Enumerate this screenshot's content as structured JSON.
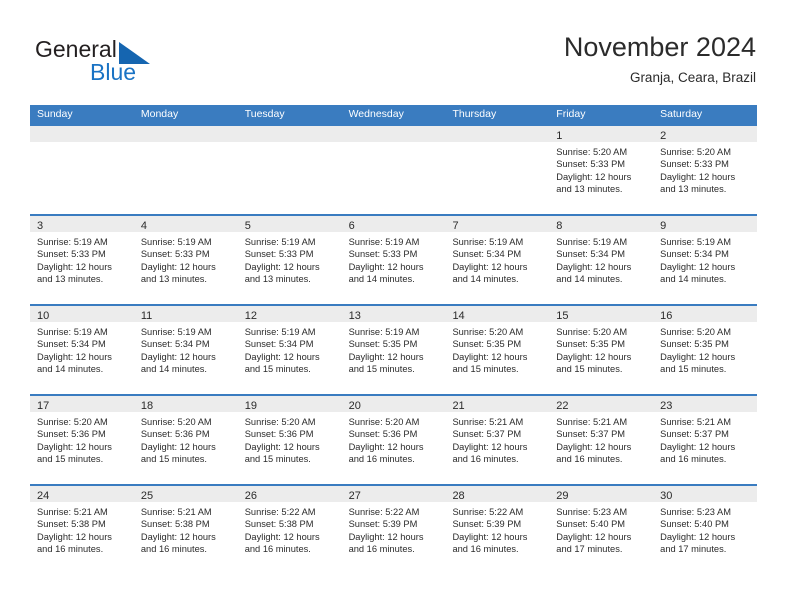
{
  "brand": {
    "name_part1": "General",
    "name_part2": "Blue",
    "logo_icon": "triangle-logo-icon",
    "accent_color": "#1565b0"
  },
  "header": {
    "title": "November 2024",
    "subtitle": "Granja, Ceara, Brazil"
  },
  "calendar": {
    "header_bg": "#3a7cc0",
    "daynum_bg": "#ececec",
    "weekdays": [
      "Sunday",
      "Monday",
      "Tuesday",
      "Wednesday",
      "Thursday",
      "Friday",
      "Saturday"
    ],
    "weeks": [
      [
        {
          "day": "",
          "sunrise": "",
          "sunset": "",
          "daylight_line1": "",
          "daylight_line2": ""
        },
        {
          "day": "",
          "sunrise": "",
          "sunset": "",
          "daylight_line1": "",
          "daylight_line2": ""
        },
        {
          "day": "",
          "sunrise": "",
          "sunset": "",
          "daylight_line1": "",
          "daylight_line2": ""
        },
        {
          "day": "",
          "sunrise": "",
          "sunset": "",
          "daylight_line1": "",
          "daylight_line2": ""
        },
        {
          "day": "",
          "sunrise": "",
          "sunset": "",
          "daylight_line1": "",
          "daylight_line2": ""
        },
        {
          "day": "1",
          "sunrise": "Sunrise: 5:20 AM",
          "sunset": "Sunset: 5:33 PM",
          "daylight_line1": "Daylight: 12 hours",
          "daylight_line2": "and 13 minutes."
        },
        {
          "day": "2",
          "sunrise": "Sunrise: 5:20 AM",
          "sunset": "Sunset: 5:33 PM",
          "daylight_line1": "Daylight: 12 hours",
          "daylight_line2": "and 13 minutes."
        }
      ],
      [
        {
          "day": "3",
          "sunrise": "Sunrise: 5:19 AM",
          "sunset": "Sunset: 5:33 PM",
          "daylight_line1": "Daylight: 12 hours",
          "daylight_line2": "and 13 minutes."
        },
        {
          "day": "4",
          "sunrise": "Sunrise: 5:19 AM",
          "sunset": "Sunset: 5:33 PM",
          "daylight_line1": "Daylight: 12 hours",
          "daylight_line2": "and 13 minutes."
        },
        {
          "day": "5",
          "sunrise": "Sunrise: 5:19 AM",
          "sunset": "Sunset: 5:33 PM",
          "daylight_line1": "Daylight: 12 hours",
          "daylight_line2": "and 13 minutes."
        },
        {
          "day": "6",
          "sunrise": "Sunrise: 5:19 AM",
          "sunset": "Sunset: 5:33 PM",
          "daylight_line1": "Daylight: 12 hours",
          "daylight_line2": "and 14 minutes."
        },
        {
          "day": "7",
          "sunrise": "Sunrise: 5:19 AM",
          "sunset": "Sunset: 5:34 PM",
          "daylight_line1": "Daylight: 12 hours",
          "daylight_line2": "and 14 minutes."
        },
        {
          "day": "8",
          "sunrise": "Sunrise: 5:19 AM",
          "sunset": "Sunset: 5:34 PM",
          "daylight_line1": "Daylight: 12 hours",
          "daylight_line2": "and 14 minutes."
        },
        {
          "day": "9",
          "sunrise": "Sunrise: 5:19 AM",
          "sunset": "Sunset: 5:34 PM",
          "daylight_line1": "Daylight: 12 hours",
          "daylight_line2": "and 14 minutes."
        }
      ],
      [
        {
          "day": "10",
          "sunrise": "Sunrise: 5:19 AM",
          "sunset": "Sunset: 5:34 PM",
          "daylight_line1": "Daylight: 12 hours",
          "daylight_line2": "and 14 minutes."
        },
        {
          "day": "11",
          "sunrise": "Sunrise: 5:19 AM",
          "sunset": "Sunset: 5:34 PM",
          "daylight_line1": "Daylight: 12 hours",
          "daylight_line2": "and 14 minutes."
        },
        {
          "day": "12",
          "sunrise": "Sunrise: 5:19 AM",
          "sunset": "Sunset: 5:34 PM",
          "daylight_line1": "Daylight: 12 hours",
          "daylight_line2": "and 15 minutes."
        },
        {
          "day": "13",
          "sunrise": "Sunrise: 5:19 AM",
          "sunset": "Sunset: 5:35 PM",
          "daylight_line1": "Daylight: 12 hours",
          "daylight_line2": "and 15 minutes."
        },
        {
          "day": "14",
          "sunrise": "Sunrise: 5:20 AM",
          "sunset": "Sunset: 5:35 PM",
          "daylight_line1": "Daylight: 12 hours",
          "daylight_line2": "and 15 minutes."
        },
        {
          "day": "15",
          "sunrise": "Sunrise: 5:20 AM",
          "sunset": "Sunset: 5:35 PM",
          "daylight_line1": "Daylight: 12 hours",
          "daylight_line2": "and 15 minutes."
        },
        {
          "day": "16",
          "sunrise": "Sunrise: 5:20 AM",
          "sunset": "Sunset: 5:35 PM",
          "daylight_line1": "Daylight: 12 hours",
          "daylight_line2": "and 15 minutes."
        }
      ],
      [
        {
          "day": "17",
          "sunrise": "Sunrise: 5:20 AM",
          "sunset": "Sunset: 5:36 PM",
          "daylight_line1": "Daylight: 12 hours",
          "daylight_line2": "and 15 minutes."
        },
        {
          "day": "18",
          "sunrise": "Sunrise: 5:20 AM",
          "sunset": "Sunset: 5:36 PM",
          "daylight_line1": "Daylight: 12 hours",
          "daylight_line2": "and 15 minutes."
        },
        {
          "day": "19",
          "sunrise": "Sunrise: 5:20 AM",
          "sunset": "Sunset: 5:36 PM",
          "daylight_line1": "Daylight: 12 hours",
          "daylight_line2": "and 15 minutes."
        },
        {
          "day": "20",
          "sunrise": "Sunrise: 5:20 AM",
          "sunset": "Sunset: 5:36 PM",
          "daylight_line1": "Daylight: 12 hours",
          "daylight_line2": "and 16 minutes."
        },
        {
          "day": "21",
          "sunrise": "Sunrise: 5:21 AM",
          "sunset": "Sunset: 5:37 PM",
          "daylight_line1": "Daylight: 12 hours",
          "daylight_line2": "and 16 minutes."
        },
        {
          "day": "22",
          "sunrise": "Sunrise: 5:21 AM",
          "sunset": "Sunset: 5:37 PM",
          "daylight_line1": "Daylight: 12 hours",
          "daylight_line2": "and 16 minutes."
        },
        {
          "day": "23",
          "sunrise": "Sunrise: 5:21 AM",
          "sunset": "Sunset: 5:37 PM",
          "daylight_line1": "Daylight: 12 hours",
          "daylight_line2": "and 16 minutes."
        }
      ],
      [
        {
          "day": "24",
          "sunrise": "Sunrise: 5:21 AM",
          "sunset": "Sunset: 5:38 PM",
          "daylight_line1": "Daylight: 12 hours",
          "daylight_line2": "and 16 minutes."
        },
        {
          "day": "25",
          "sunrise": "Sunrise: 5:21 AM",
          "sunset": "Sunset: 5:38 PM",
          "daylight_line1": "Daylight: 12 hours",
          "daylight_line2": "and 16 minutes."
        },
        {
          "day": "26",
          "sunrise": "Sunrise: 5:22 AM",
          "sunset": "Sunset: 5:38 PM",
          "daylight_line1": "Daylight: 12 hours",
          "daylight_line2": "and 16 minutes."
        },
        {
          "day": "27",
          "sunrise": "Sunrise: 5:22 AM",
          "sunset": "Sunset: 5:39 PM",
          "daylight_line1": "Daylight: 12 hours",
          "daylight_line2": "and 16 minutes."
        },
        {
          "day": "28",
          "sunrise": "Sunrise: 5:22 AM",
          "sunset": "Sunset: 5:39 PM",
          "daylight_line1": "Daylight: 12 hours",
          "daylight_line2": "and 16 minutes."
        },
        {
          "day": "29",
          "sunrise": "Sunrise: 5:23 AM",
          "sunset": "Sunset: 5:40 PM",
          "daylight_line1": "Daylight: 12 hours",
          "daylight_line2": "and 17 minutes."
        },
        {
          "day": "30",
          "sunrise": "Sunrise: 5:23 AM",
          "sunset": "Sunset: 5:40 PM",
          "daylight_line1": "Daylight: 12 hours",
          "daylight_line2": "and 17 minutes."
        }
      ]
    ]
  }
}
